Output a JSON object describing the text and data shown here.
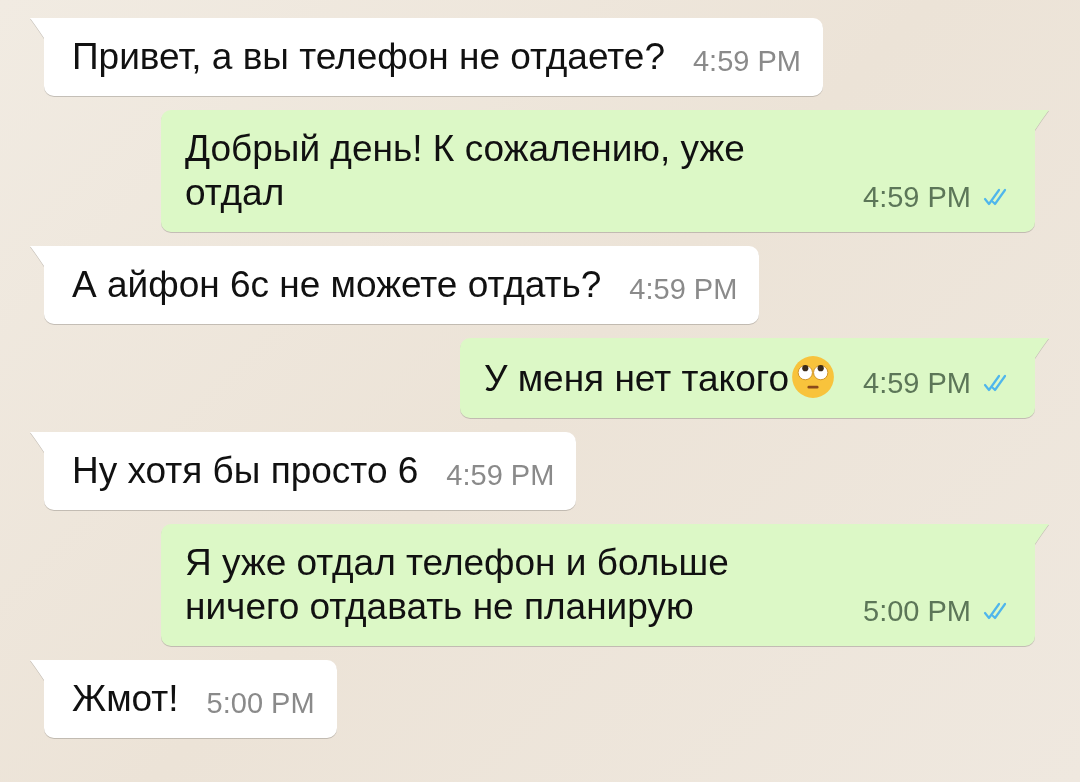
{
  "messages": [
    {
      "outgoing": false,
      "text": "Привет, а вы телефон не отдаете?",
      "time": "4:59 PM"
    },
    {
      "outgoing": true,
      "text": "Добрый день! К сожалению, уже отдал",
      "time": "4:59 PM",
      "read": true
    },
    {
      "outgoing": false,
      "text": "А айфон 6с не можете отдать?",
      "time": "4:59 PM"
    },
    {
      "outgoing": true,
      "text": "У меня нет такого",
      "emoji": true,
      "time": "4:59 PM",
      "read": true
    },
    {
      "outgoing": false,
      "text": "Ну хотя бы просто 6",
      "time": "4:59 PM"
    },
    {
      "outgoing": true,
      "text": "Я уже отдал телефон и больше ничего отдавать не планирую",
      "time": "5:00 PM",
      "read": true
    },
    {
      "outgoing": false,
      "text": "Жмот!",
      "time": "5:00 PM"
    }
  ]
}
